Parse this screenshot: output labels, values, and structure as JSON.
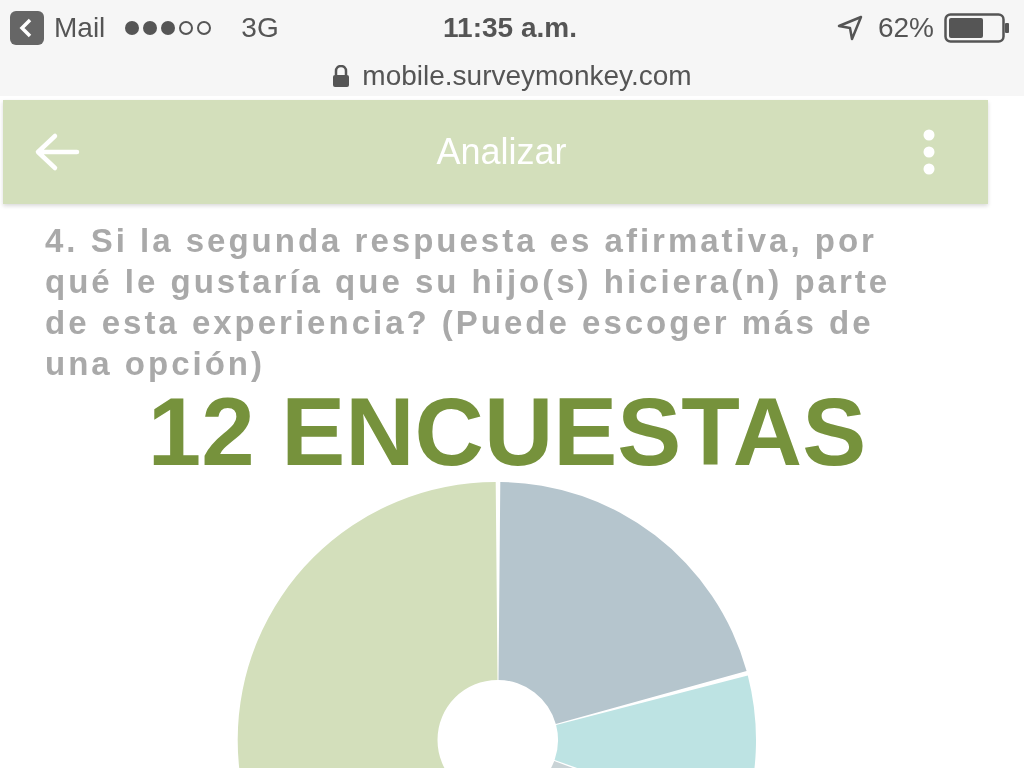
{
  "status_bar": {
    "back_app": "Mail",
    "network": "3G",
    "time": "11:35 a.m.",
    "battery": "62%"
  },
  "address_bar": {
    "url": "mobile.surveymonkey.com"
  },
  "app_bar": {
    "title": "Analizar"
  },
  "question": "4. Si la segunda respuesta es afirmativa, por qué le gustaría que su hijo(s) hiciera(n) parte de esta experiencia? (Puede escoger más de una opción)",
  "overlay_title": "12 ENCUESTAS"
}
